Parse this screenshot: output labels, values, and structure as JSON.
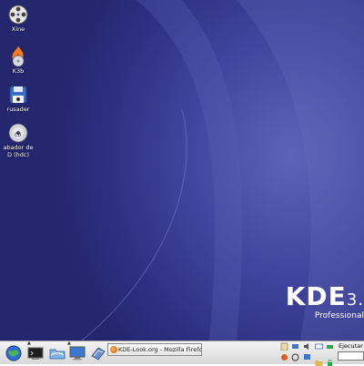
{
  "desktop": {
    "icons": [
      {
        "icon": "film-reel-icon",
        "label": "Xine"
      },
      {
        "icon": "k3b-flame-disc-icon",
        "label": "K3b"
      },
      {
        "icon": "krusader-floppy-icon",
        "label": "rusader"
      },
      {
        "icon": "cd-burner-icon",
        "label_line1": "abador de",
        "label_line2": "D (hdc)"
      }
    ],
    "brand": {
      "name": "KDE",
      "version": "3.",
      "edition": "Professional"
    }
  },
  "panel": {
    "launchers": [
      "globe-icon",
      "terminal-icon",
      "file-manager-icon",
      "monitor-icon",
      "notepad-icon"
    ],
    "task": {
      "label": "KDE-Look.org - Mozilla Firefox",
      "icon": "firefox-icon"
    },
    "tray_icons": [
      "clipboard-icon",
      "network-icon",
      "volume-icon",
      "mail-icon",
      "printer-icon",
      "update-icon",
      "power-icon",
      "display-icon"
    ],
    "run": {
      "label": "Ejecutar c",
      "value": ""
    }
  },
  "colors": {
    "desktop": "#3b3f96",
    "panel": "#e2e2e2",
    "brand_text": "#ffffff"
  }
}
